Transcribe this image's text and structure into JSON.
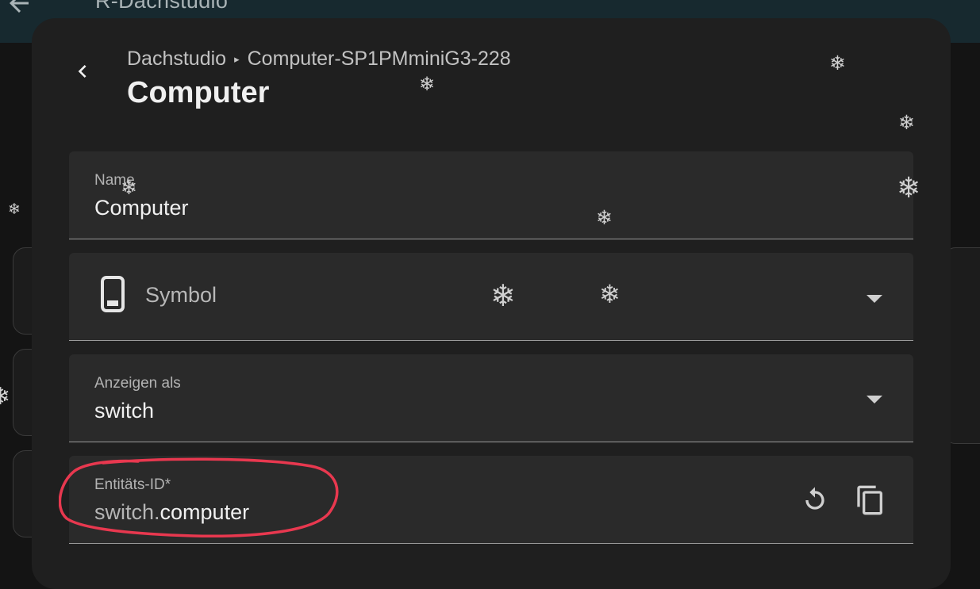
{
  "topbar": {
    "title": "R-Dachstudio"
  },
  "dialog": {
    "breadcrumb": {
      "area": "Dachstudio",
      "separator": "▸",
      "device": "Computer-SP1PMminiG3-228"
    },
    "title": "Computer"
  },
  "form": {
    "name": {
      "label": "Name",
      "value": "Computer"
    },
    "symbol": {
      "placeholder": "Symbol",
      "icon": "cellphone-icon"
    },
    "show_as": {
      "label": "Anzeigen als",
      "value": "switch"
    },
    "entity_id": {
      "label": "Entitäts-ID*",
      "domain_prefix": "switch.",
      "object_id": "computer",
      "actions": [
        "restore-icon",
        "copy-icon"
      ]
    }
  },
  "decor": {
    "snowflake_glyph": "❄",
    "annotation_color": "#e8384f"
  }
}
